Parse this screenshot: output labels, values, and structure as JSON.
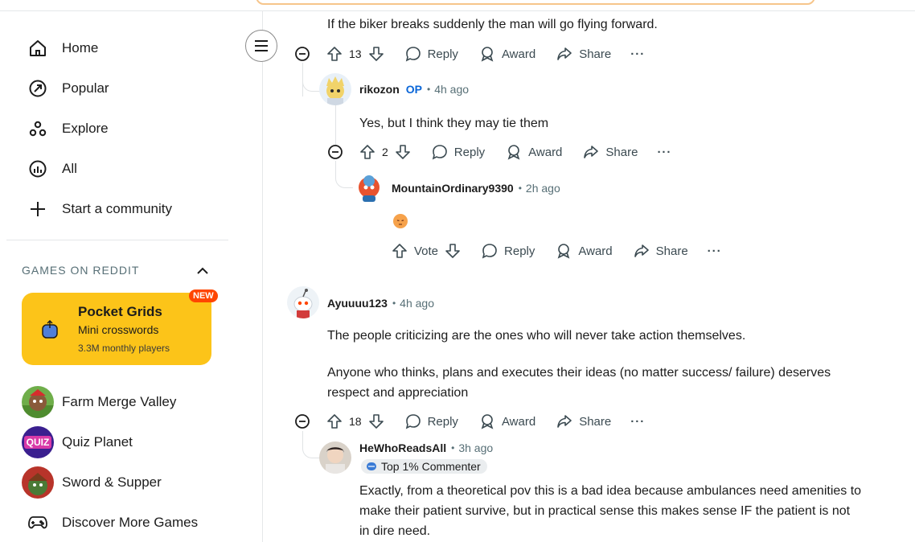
{
  "sidebar": {
    "nav": [
      {
        "label": "Home",
        "icon": "home-icon"
      },
      {
        "label": "Popular",
        "icon": "popular-icon"
      },
      {
        "label": "Explore",
        "icon": "explore-icon"
      },
      {
        "label": "All",
        "icon": "all-icon"
      },
      {
        "label": "Start a community",
        "icon": "plus-icon"
      }
    ],
    "games_heading": "GAMES ON REDDIT",
    "promo": {
      "title": "Pocket Grids",
      "subtitle": "Mini crosswords",
      "players": "3.3M monthly players",
      "badge": "NEW"
    },
    "games": [
      {
        "label": "Farm Merge Valley"
      },
      {
        "label": "Quiz Planet",
        "avatar_text": "QUIZ"
      },
      {
        "label": "Sword & Supper"
      },
      {
        "label": "Discover More Games"
      }
    ]
  },
  "actions": {
    "reply": "Reply",
    "award": "Award",
    "share": "Share",
    "more": "···",
    "vote": "Vote"
  },
  "comments": [
    {
      "text": "If the biker breaks suddenly the man will go flying forward.",
      "score": "13"
    },
    {
      "author": "rikozon",
      "op": "OP",
      "sep": "•",
      "time": "4h ago",
      "text": "Yes, but I think they may tie them",
      "score": "2"
    },
    {
      "author": "MountainOrdinary9390",
      "sep": "•",
      "time": "2h ago",
      "emoji": "pensive-face-emoji"
    },
    {
      "author": "Ayuuuu123",
      "sep": "•",
      "time": "4h ago",
      "text1": "The people criticizing are the ones who will never take action themselves.",
      "text2": "Anyone who thinks, plans and executes their ideas (no matter success/ failure) deserves",
      "text3": "respect and appreciation",
      "score": "18"
    },
    {
      "author": "HeWhoReadsAll",
      "sep": "•",
      "time": "3h ago",
      "flair": "Top 1% Commenter",
      "text1": "Exactly, from a theoretical pov this is a bad idea because ambulances need amenities to",
      "text2": "make their patient survive, but in practical sense this makes sense IF the patient is not",
      "text3": "in dire need."
    }
  ],
  "colors": {
    "accent_yellow": "#fcc419",
    "new_badge": "#ff4500",
    "op_blue": "#0a66d8",
    "thread_line": "#e0e3e5"
  }
}
